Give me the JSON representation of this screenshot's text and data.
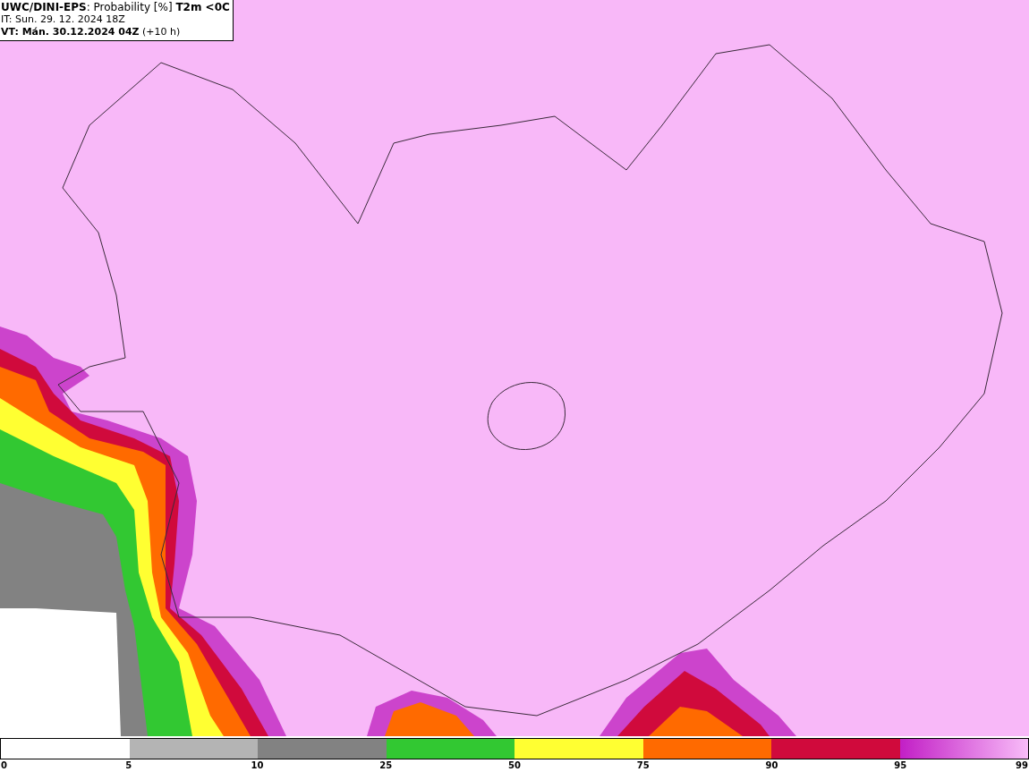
{
  "header": {
    "lines": [
      "**UWC/DINI-EPS**: Probability [%] **T2m <0C**",
      "IT: Sun. 29. 12. 2024 18Z",
      "**VT: Mán. 30.12.2024 04Z** (+10 h)"
    ]
  },
  "legend": {
    "start_label": "0",
    "segments": [
      {
        "kind": "blank",
        "label": "5"
      },
      {
        "kind": "solid",
        "color": "#b4b4b4",
        "label": "10"
      },
      {
        "kind": "solid",
        "color": "#828282",
        "label": "25"
      },
      {
        "kind": "solid",
        "color": "#32c832",
        "label": "50"
      },
      {
        "kind": "solid",
        "color": "#ffff32",
        "label": "75"
      },
      {
        "kind": "solid",
        "color": "#ff6a00",
        "label": "90"
      },
      {
        "kind": "solid",
        "color": "#d00a3c",
        "label": "95"
      },
      {
        "kind": "gradient",
        "label": "99"
      }
    ]
  }
}
